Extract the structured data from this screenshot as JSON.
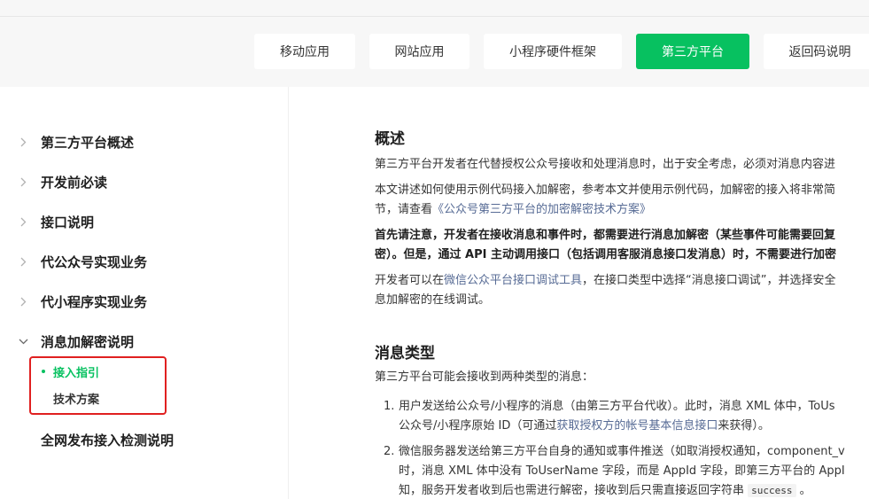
{
  "header": {
    "tabs": [
      {
        "label": "移动应用"
      },
      {
        "label": "网站应用"
      },
      {
        "label": "小程序硬件框架"
      },
      {
        "label": "第三方平台",
        "active": true
      },
      {
        "label": "返回码说明"
      }
    ]
  },
  "sidebar": {
    "items": [
      {
        "label": "第三方平台概述"
      },
      {
        "label": "开发前必读"
      },
      {
        "label": "接口说明"
      },
      {
        "label": "代公众号实现业务"
      },
      {
        "label": "代小程序实现业务"
      },
      {
        "label": "消息加解密说明",
        "expanded": true
      },
      {
        "label": "全网发布接入检测说明"
      }
    ],
    "subitems": [
      {
        "label": "接入指引",
        "active": true
      },
      {
        "label": "技术方案"
      }
    ]
  },
  "content": {
    "overview_title": "概述",
    "p1": "第三方平台开发者在代替授权公众号接收和处理消息时，出于安全考虑，必须对消息内容进",
    "p2_line1": "本文讲述如何使用示例代码接入加解密，参考本文并使用示例代码，加解密的接入将非常简",
    "p2_line2_a": "节，请查看",
    "p2_line2_link": "《公众号第三方平台的加密解密技术方案》",
    "p3_line1": "首先请注意，开发者在接收消息和事件时，都需要进行消息加解密（某些事件可能需要回复",
    "p3_line2": "密）。但是，通过 API 主动调用接口（包括调用客服消息接口发消息）时，不需要进行加密",
    "p4_line1_a": "开发者可以在",
    "p4_line1_link": "微信公众平台接口调试工具",
    "p4_line1_b": "，在接口类型中选择“消息接口调试”，并选择安全",
    "p4_line2": "息加解密的在线调试。",
    "types_title": "消息类型",
    "p5": "第三方平台可能会接收到两种类型的消息：",
    "li1_num": "1.",
    "li1_line1": "用户发送给公众号/小程序的消息（由第三方平台代收）。此时，消息 XML 体中，ToUs",
    "li1_line2_a": "公众号/小程序原始 ID（可通过",
    "li1_line2_link": "获取授权方的帐号基本信息接口",
    "li1_line2_b": "来获得）。",
    "li2_num": "2.",
    "li2_line1": "微信服务器发送给第三方平台自身的通知或事件推送（如取消授权通知，component_v",
    "li2_line2": "时，消息 XML 体中没有 ToUserName 字段，而是 AppId 字段，即第三方平台的 AppI",
    "li2_line3_a": "知，服务开发者收到后也需进行解密，接收到后只需直接返回字符串 ",
    "li2_line3_code": "success",
    "li2_line3_b": " 。"
  },
  "colors": {
    "accent": "#07c160",
    "link": "#576b95",
    "highlight_border": "#e02020"
  }
}
